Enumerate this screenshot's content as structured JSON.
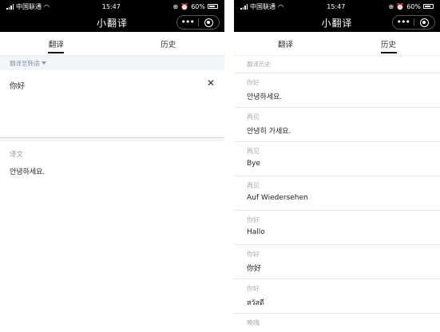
{
  "status_bar": {
    "carrier": "中国联通",
    "time": "15:47",
    "battery_left": "60%",
    "battery_right": "60%"
  },
  "nav": {
    "title": "小翻译",
    "more_label": "•••"
  },
  "tabs": [
    {
      "label": "翻译"
    },
    {
      "label": "历史"
    }
  ],
  "translate": {
    "target_language": "翻译至韩语",
    "input_text": "你好",
    "clear_label": "✕",
    "result_label": "译文",
    "result_text": "안녕하세요."
  },
  "history": {
    "header": "翻译历史",
    "items": [
      {
        "source": "你好",
        "target": "안녕하세요."
      },
      {
        "source": "再见",
        "target": "안녕히 가세요."
      },
      {
        "source": "再见",
        "target": "Bye"
      },
      {
        "source": "再见",
        "target": "Auf Wiedersehen"
      },
      {
        "source": "你好",
        "target": "Hallo"
      },
      {
        "source": "你好",
        "target": "你好"
      },
      {
        "source": "你好",
        "target": "สวัสดี"
      },
      {
        "source": "晚嗨",
        "target": ""
      }
    ]
  }
}
